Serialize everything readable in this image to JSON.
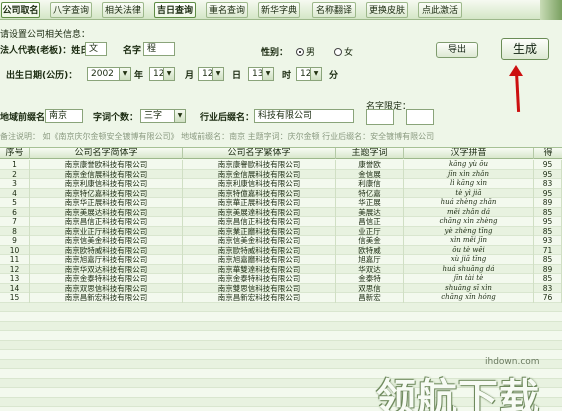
{
  "tabs": [
    {
      "label": "公司取名",
      "active": true
    },
    {
      "label": "八字查询",
      "active": false
    },
    {
      "label": "相关法律",
      "active": false
    },
    {
      "label": "吉日查询",
      "active": true
    },
    {
      "label": "重名查询",
      "active": false
    },
    {
      "label": "新华字典",
      "active": false
    },
    {
      "label": "名称翻译",
      "active": false
    },
    {
      "label": "更换皮肤",
      "active": false
    },
    {
      "label": "点此激活",
      "active": false
    }
  ],
  "form": {
    "section_title": "请设置公司相关信息：",
    "legal_rep_label": "法人代表(老板)：姓氏",
    "surname_value": "文",
    "name_label": "名字",
    "name_value": "程",
    "gender_label": "性别：",
    "gender_male": "男",
    "gender_female": "女",
    "birth_label": "出生日期(公历)：",
    "year_value": "2002",
    "year_unit": "年",
    "month_value": "12",
    "month_unit": "月",
    "day_value": "12",
    "day_unit": "日",
    "hour_value": "13",
    "hour_unit": "时",
    "minute_value": "12",
    "minute_unit": "分",
    "region_label": "地域前缀名：",
    "region_value": "南京",
    "count_label": "字词个数：",
    "count_value": "三字",
    "industry_label": "行业后缀名：",
    "industry_value": "科技有限公司",
    "must_include_label": "名字限定：",
    "export_button": "导出",
    "generate_button": "生成",
    "hint_text": "备注说明：  如《南京庆尔金顿安全镀博有限公司》        地域前缀名：南京      主题字词：庆尔金顿              行业后缀名：安全镀博有限公司"
  },
  "table": {
    "headers": [
      "序号",
      "公司名字简体字",
      "公司名字繁体字",
      "主题字词",
      "汉字拼音",
      "得"
    ],
    "rows": [
      {
        "no": "1",
        "simp": "南京康誉欧科技有限公司",
        "trad": "南京康譽歐科技有限公司",
        "word": "康誉欧",
        "pinyin": "kāng yù ōu",
        "score": "95"
      },
      {
        "no": "2",
        "simp": "南京金信展科技有限公司",
        "trad": "南京金信展科技有限公司",
        "word": "金信展",
        "pinyin": "jīn xìn zhǎn",
        "score": "95"
      },
      {
        "no": "3",
        "simp": "南京利康信科技有限公司",
        "trad": "南京利康信科技有限公司",
        "word": "利康信",
        "pinyin": "lì kāng xìn",
        "score": "83"
      },
      {
        "no": "4",
        "simp": "南京特亿嘉科技有限公司",
        "trad": "南京特億嘉科技有限公司",
        "word": "特亿嘉",
        "pinyin": "tè yì jiā",
        "score": "95"
      },
      {
        "no": "5",
        "simp": "南京华正展科技有限公司",
        "trad": "南京華正展科技有限公司",
        "word": "华正展",
        "pinyin": "huá zhèng zhǎn",
        "score": "89"
      },
      {
        "no": "6",
        "simp": "南京美展达科技有限公司",
        "trad": "南京美展達科技有限公司",
        "word": "美展达",
        "pinyin": "měi zhǎn dá",
        "score": "85"
      },
      {
        "no": "7",
        "simp": "南京昌信正科技有限公司",
        "trad": "南京昌信正科技有限公司",
        "word": "昌信正",
        "pinyin": "chāng xìn zhèng",
        "score": "95"
      },
      {
        "no": "8",
        "simp": "南京业正厅科技有限公司",
        "trad": "南京業正廳科技有限公司",
        "word": "业正厅",
        "pinyin": "yè zhèng tīng",
        "score": "85"
      },
      {
        "no": "9",
        "simp": "南京信美金科技有限公司",
        "trad": "南京信美金科技有限公司",
        "word": "信美金",
        "pinyin": "xìn měi jīn",
        "score": "93"
      },
      {
        "no": "10",
        "simp": "南京欧特威科技有限公司",
        "trad": "南京歐特威科技有限公司",
        "word": "欧特威",
        "pinyin": "ōu tè wēi",
        "score": "71"
      },
      {
        "no": "11",
        "simp": "南京旭嘉厅科技有限公司",
        "trad": "南京旭嘉廳科技有限公司",
        "word": "旭嘉厅",
        "pinyin": "xù jiā tīng",
        "score": "85"
      },
      {
        "no": "12",
        "simp": "南京华双达科技有限公司",
        "trad": "南京華雙達科技有限公司",
        "word": "华双达",
        "pinyin": "huá shuāng dá",
        "score": "89"
      },
      {
        "no": "13",
        "simp": "南京金泰特科技有限公司",
        "trad": "南京金泰特科技有限公司",
        "word": "金泰特",
        "pinyin": "jīn tài tè",
        "score": "85"
      },
      {
        "no": "14",
        "simp": "南京双思信科技有限公司",
        "trad": "南京雙思信科技有限公司",
        "word": "双思信",
        "pinyin": "shuāng sī xìn",
        "score": "83"
      },
      {
        "no": "15",
        "simp": "南京昌新宏科技有限公司",
        "trad": "南京昌新宏科技有限公司",
        "word": "昌新宏",
        "pinyin": "chāng xīn hóng",
        "score": "76"
      }
    ]
  },
  "watermark": {
    "url": "ihdown.com",
    "text": "领航下载"
  }
}
